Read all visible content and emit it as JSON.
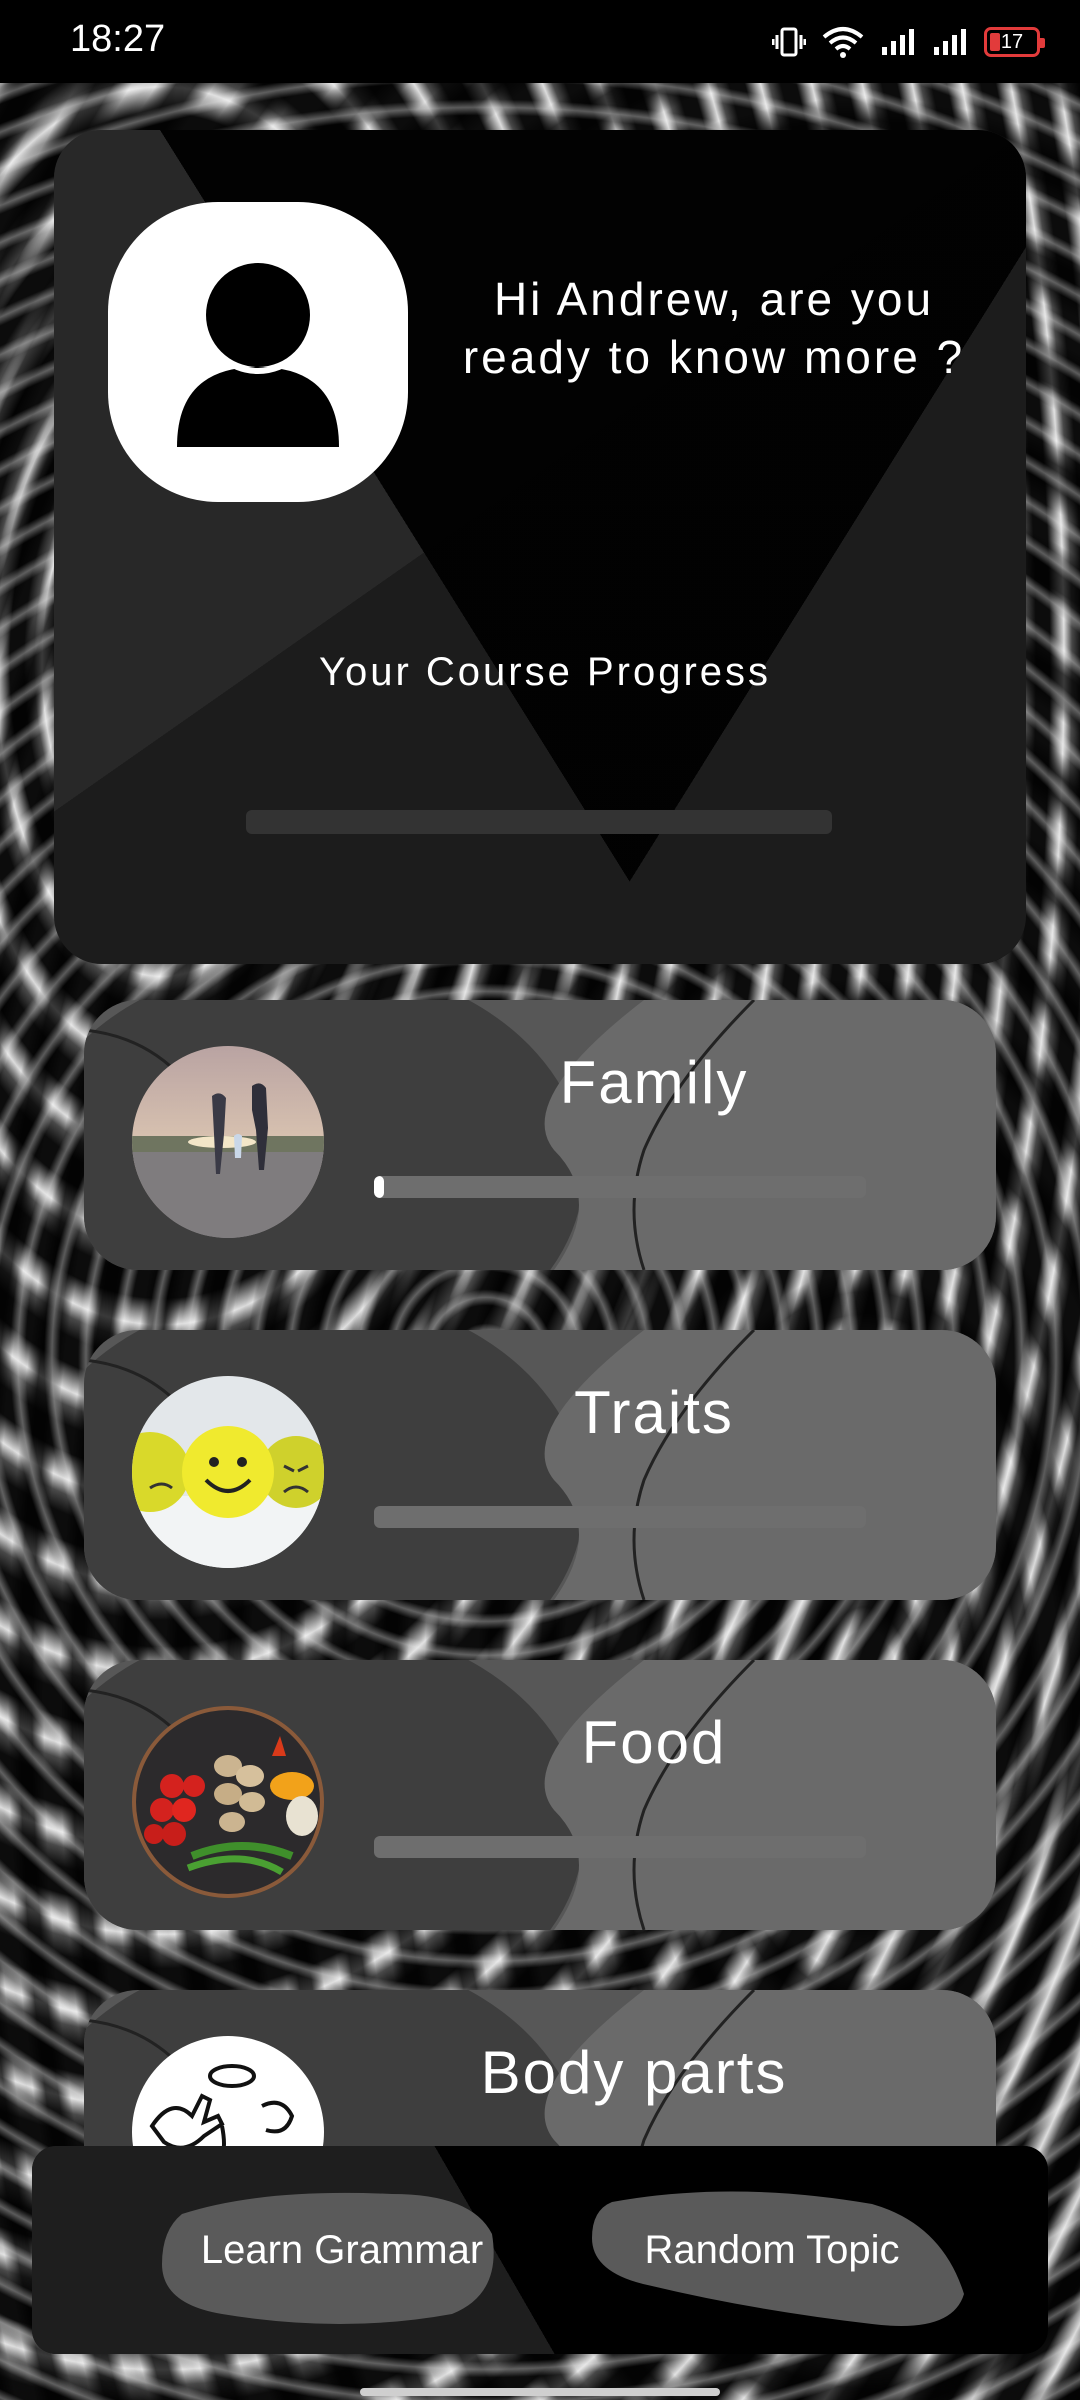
{
  "status_bar": {
    "time": "18:27",
    "battery_level": "17",
    "icons": [
      "vibrate-icon",
      "wifi-icon",
      "signal-icon",
      "signal-icon",
      "battery-icon"
    ]
  },
  "profile": {
    "greeting": "Hi Andrew, are you ready to know more ?",
    "progress_title": "Your Course Progress",
    "course_progress": 0,
    "avatar_icon": "user-silhouette-icon"
  },
  "topics": [
    {
      "title": "Family",
      "progress": 0.02,
      "image": "family-photo"
    },
    {
      "title": "Traits",
      "progress": 0,
      "image": "emoji-balls-photo"
    },
    {
      "title": "Food",
      "progress": 0,
      "image": "food-bowl-photo"
    },
    {
      "title": "Body parts",
      "progress": 0,
      "image": "body-parts-sketch"
    }
  ],
  "bottom_bar": {
    "learn_grammar": "Learn Grammar",
    "random_topic": "Random Topic"
  },
  "colors": {
    "card_dark": "#1c1c1c",
    "topic_card": "#575757",
    "battery_low": "#e23b3b"
  }
}
